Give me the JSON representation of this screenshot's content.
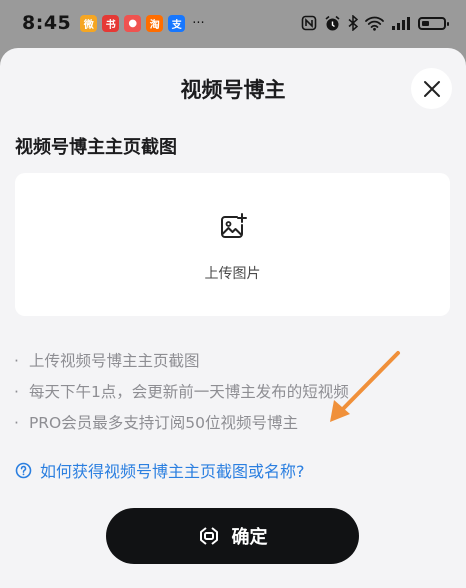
{
  "status_bar": {
    "time": "8:45",
    "more": "···",
    "app_icons": [
      {
        "name": "weibo-app-icon",
        "glyph": "微",
        "color": "#f5a623"
      },
      {
        "name": "red-app-icon",
        "glyph": "书",
        "color": "#e53935"
      },
      {
        "name": "notify-app-icon",
        "glyph": "●",
        "color": "#ef5350"
      },
      {
        "name": "taobao-app-icon",
        "glyph": "淘",
        "color": "#ff6d00"
      },
      {
        "name": "alipay-app-icon",
        "glyph": "支",
        "color": "#1677ff"
      }
    ],
    "battery_percent": 35
  },
  "dialog": {
    "title": "视频号博主",
    "close_icon": "close-icon",
    "section_label": "视频号博主主页截图",
    "upload": {
      "icon": "image-add-icon",
      "label": "上传图片"
    },
    "tips": [
      "上传视频号博主主页截图",
      "每天下午1点，会更新前一天博主发布的短视频",
      "PRO会员最多支持订阅50位视频号博主"
    ],
    "tip_bullet": "·",
    "help_link": "如何获得视频号博主主页截图或名称?",
    "confirm_label": "确定"
  },
  "colors": {
    "accent_link": "#2b7fe0",
    "arrow": "#f0903a",
    "button_bg": "#111214",
    "sheet_bg": "#f4f4f6"
  }
}
